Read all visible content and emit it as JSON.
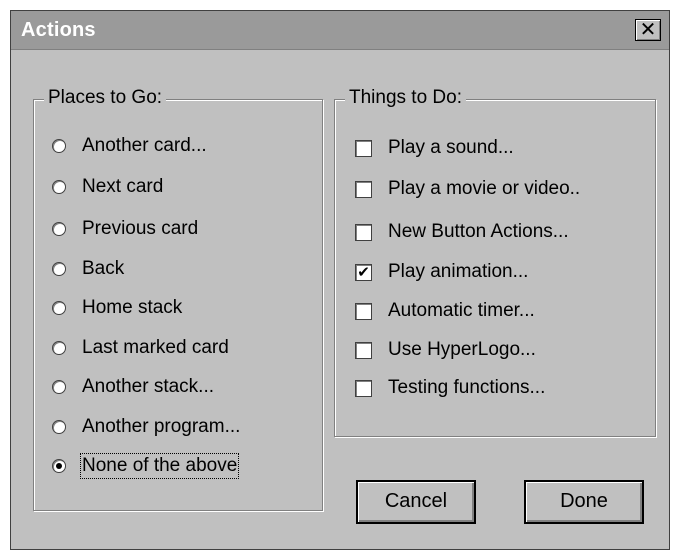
{
  "window": {
    "title": "Actions",
    "close_glyph": "✕"
  },
  "places": {
    "label": "Places to Go:",
    "items": [
      {
        "label": "Another card...",
        "selected": false
      },
      {
        "label": "Next card",
        "selected": false
      },
      {
        "label": "Previous card",
        "selected": false
      },
      {
        "label": "Back",
        "selected": false
      },
      {
        "label": "Home stack",
        "selected": false
      },
      {
        "label": "Last marked card",
        "selected": false
      },
      {
        "label": "Another stack...",
        "selected": false
      },
      {
        "label": "Another program...",
        "selected": false
      },
      {
        "label": "None of the above",
        "selected": true
      }
    ]
  },
  "things": {
    "label": "Things to Do:",
    "items": [
      {
        "label": "Play a sound...",
        "checked": false
      },
      {
        "label": "Play a movie or video..",
        "checked": false
      },
      {
        "label": "New Button Actions...",
        "checked": false
      },
      {
        "label": "Play animation...",
        "checked": true
      },
      {
        "label": "Automatic timer...",
        "checked": false
      },
      {
        "label": "Use HyperLogo...",
        "checked": false
      },
      {
        "label": "Testing functions...",
        "checked": false
      }
    ],
    "check_glyph": "✔"
  },
  "buttons": {
    "cancel": "Cancel",
    "done": "Done"
  }
}
